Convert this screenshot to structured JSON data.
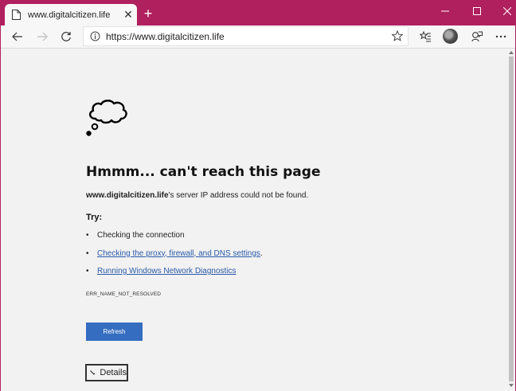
{
  "tab": {
    "title": "www.digitalcitizen.life",
    "close_glyph": "✕"
  },
  "newtab": {
    "glyph": "+"
  },
  "address": {
    "url": "https://www.digitalcitizen.life"
  },
  "error_page": {
    "heading": "Hmmm... can't reach this page",
    "domain": "www.digitalcitizen.life",
    "message_rest": "'s server IP address could not be found.",
    "try_label": "Try:",
    "suggestions": [
      {
        "text": "Checking the connection",
        "link": false
      },
      {
        "text": "Checking the proxy, firewall, and DNS settings",
        "suffix": ".",
        "link": true
      },
      {
        "text": "Running Windows Network Diagnostics",
        "link": true
      }
    ],
    "error_code": "ERR_NAME_NOT_RESOLVED",
    "refresh_label": "Refresh",
    "details_label": "Details"
  },
  "colors": {
    "accent": "#b01f5e",
    "button": "#356dc0",
    "link": "#2a5aa8"
  }
}
